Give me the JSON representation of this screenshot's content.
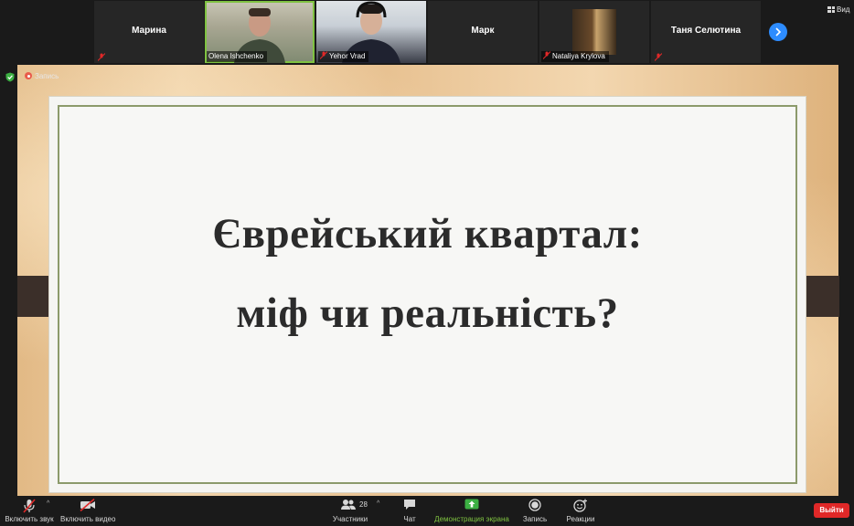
{
  "participants": [
    {
      "name": "Марина",
      "muted": true
    },
    {
      "name": "Olena Ishchenko",
      "muted": false,
      "active": true
    },
    {
      "name": "Yehor Vrad",
      "muted": true
    },
    {
      "name": "Марк",
      "muted": false
    },
    {
      "name": "Nataliya Krylova",
      "muted": true
    },
    {
      "name": "Таня Селютина",
      "muted": true
    }
  ],
  "view_label": "Вид",
  "recording_label": "Запись",
  "slide": {
    "line1": "Єврейський квартал:",
    "line2": "міф чи реальність?"
  },
  "toolbar": {
    "unmute_label": "Включить звук",
    "start_video_label": "Включить видео",
    "participants_label": "Участники",
    "participants_count": "28",
    "chat_label": "Чат",
    "share_label": "Демонстрация экрана",
    "record_label": "Запись",
    "reactions_label": "Реакции",
    "leave_label": "Выйти"
  },
  "colors": {
    "accent_green": "#7fc241",
    "zoom_blue": "#2d8cff",
    "leave_red": "#e02828",
    "slide_border": "#8c9a6b"
  },
  "icons": [
    "mic-muted-icon",
    "video-off-icon",
    "participants-icon",
    "chat-icon",
    "share-screen-icon",
    "record-icon",
    "reactions-icon",
    "next-page-icon",
    "view-grid-icon",
    "shield-icon",
    "recording-dot-icon"
  ]
}
